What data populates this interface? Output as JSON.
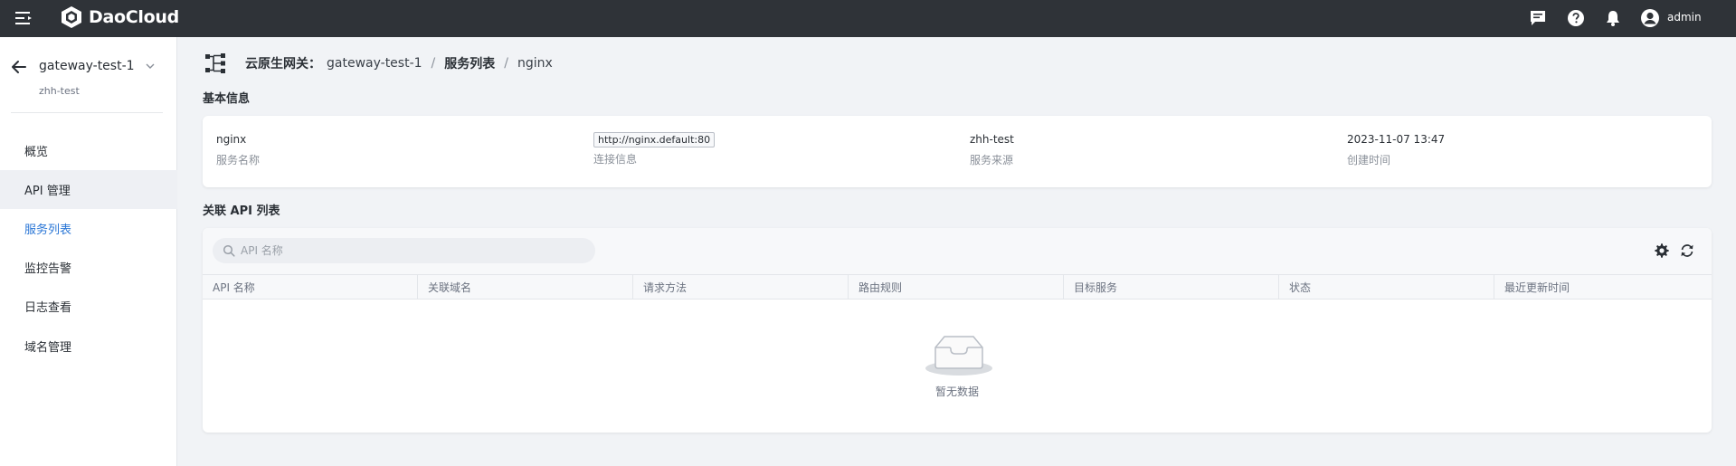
{
  "topbar": {
    "brand": "DaoCloud",
    "user": "admin",
    "icons": [
      "message-icon",
      "help-icon",
      "bell-icon",
      "user-avatar-icon"
    ]
  },
  "sidebar": {
    "gateway_name": "gateway-test-1",
    "namespace": "zhh-test",
    "items": [
      {
        "label": "概览"
      },
      {
        "label": "API 管理"
      },
      {
        "label": "服务列表"
      },
      {
        "label": "监控告警"
      },
      {
        "label": "日志查看"
      },
      {
        "label": "域名管理"
      }
    ]
  },
  "breadcrumb": {
    "root": "云原生网关：",
    "gateway": "gateway-test-1",
    "sep": "/",
    "section": "服务列表",
    "current": "nginx"
  },
  "basic_info": {
    "title": "基本信息",
    "fields": [
      {
        "value": "nginx",
        "label": "服务名称"
      },
      {
        "value": "http://nginx.default:80",
        "label": "连接信息"
      },
      {
        "value": "zhh-test",
        "label": "服务来源"
      },
      {
        "value": "2023-11-07 13:47",
        "label": "创建时间"
      }
    ]
  },
  "api_list": {
    "title": "关联 API 列表",
    "search_placeholder": "API 名称",
    "columns": [
      "API 名称",
      "关联域名",
      "请求方法",
      "路由规则",
      "目标服务",
      "状态",
      "最近更新时间"
    ],
    "empty_text": "暂无数据"
  }
}
